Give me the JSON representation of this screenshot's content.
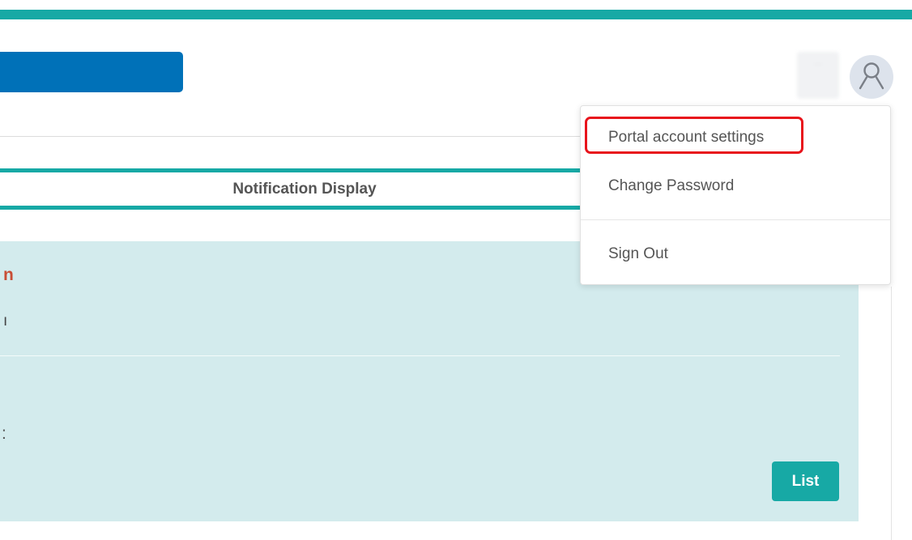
{
  "header": {
    "user_name_placeholder": "···",
    "avatar_icon": "user-icon"
  },
  "tabs": {
    "notification_display": "Notification Display"
  },
  "panel": {
    "title_fragment": "n",
    "text_fragment": "ı",
    "text_fragment2": ":"
  },
  "buttons": {
    "list_label": "List"
  },
  "account_menu": {
    "items": [
      {
        "label": "Portal account settings",
        "highlighted": true
      },
      {
        "label": "Change Password",
        "highlighted": false
      },
      {
        "label": "Sign Out",
        "highlighted": false
      }
    ]
  },
  "colors": {
    "accent_teal": "#17a9a5",
    "brand_blue": "#0071b8",
    "panel_bg": "#d3ebed",
    "highlight_red": "#e8141c",
    "title_red": "#c84e36"
  }
}
